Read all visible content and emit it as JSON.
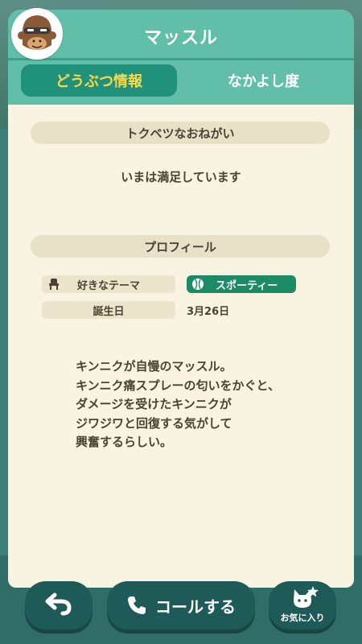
{
  "villager": {
    "name": "マッスル"
  },
  "tabs": [
    {
      "label": "どうぶつ情報",
      "active": true
    },
    {
      "label": "なかよし度",
      "active": false
    }
  ],
  "special_request": {
    "heading": "トクベツなおねがい",
    "status": "いまは満足しています"
  },
  "profile": {
    "heading": "プロフィール",
    "theme_label": "好きなテーマ",
    "theme_value": "スポーティー",
    "birthday_label": "誕生日",
    "birthday_value": "3月26日"
  },
  "description_lines": [
    "キンニクが自慢のマッスル。",
    "キンニク痛スプレーの匂いをかぐと、",
    "ダメージを受けたキンニクが",
    "ジワジワと回復する気がして",
    "興奮するらしい。"
  ],
  "buttons": {
    "back_icon": "undo-arrow-icon",
    "call_label": "コールする",
    "call_icon": "phone-icon",
    "favorite_label": "お気に入り",
    "favorite_icon": "cat-face-icon"
  },
  "colors": {
    "header": "#61bea9",
    "active_tab": "#20917a",
    "active_tab_text": "#f7d94a",
    "card_bg": "#f8f4e1",
    "theme_badge": "#1c8a64",
    "button_bg": "#1e5a57"
  }
}
